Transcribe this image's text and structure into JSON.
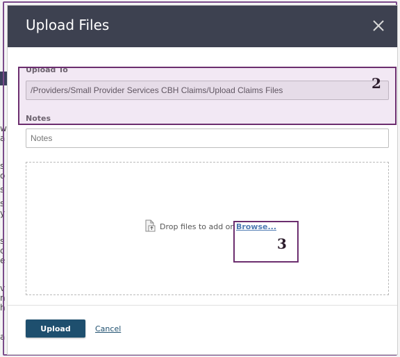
{
  "background": {
    "fragments": [
      "w",
      "a",
      "s",
      "o",
      "s",
      "s",
      "y",
      "s",
      "c",
      "e",
      "v",
      "n",
      "h",
      "a"
    ]
  },
  "dialog": {
    "title": "Upload Files",
    "close_icon": "close-icon"
  },
  "form": {
    "upload_to_label": "Upload To",
    "upload_to_value": "/Providers/Small Provider Services CBH Claims/Upload Claims Files",
    "notes_label": "Notes",
    "notes_placeholder": "Notes",
    "notes_value": ""
  },
  "dropzone": {
    "icon": "file-upload-icon",
    "text": "Drop files to add or",
    "browse_label": "Browse..."
  },
  "footer": {
    "upload_label": "Upload",
    "cancel_label": "Cancel"
  },
  "annotations": {
    "step2": "2",
    "step3": "3",
    "highlight_color": "#6b2d6e"
  },
  "colors": {
    "header_bg": "#3d4150",
    "primary_button": "#1e4f6e",
    "link": "#4f7bb3"
  }
}
